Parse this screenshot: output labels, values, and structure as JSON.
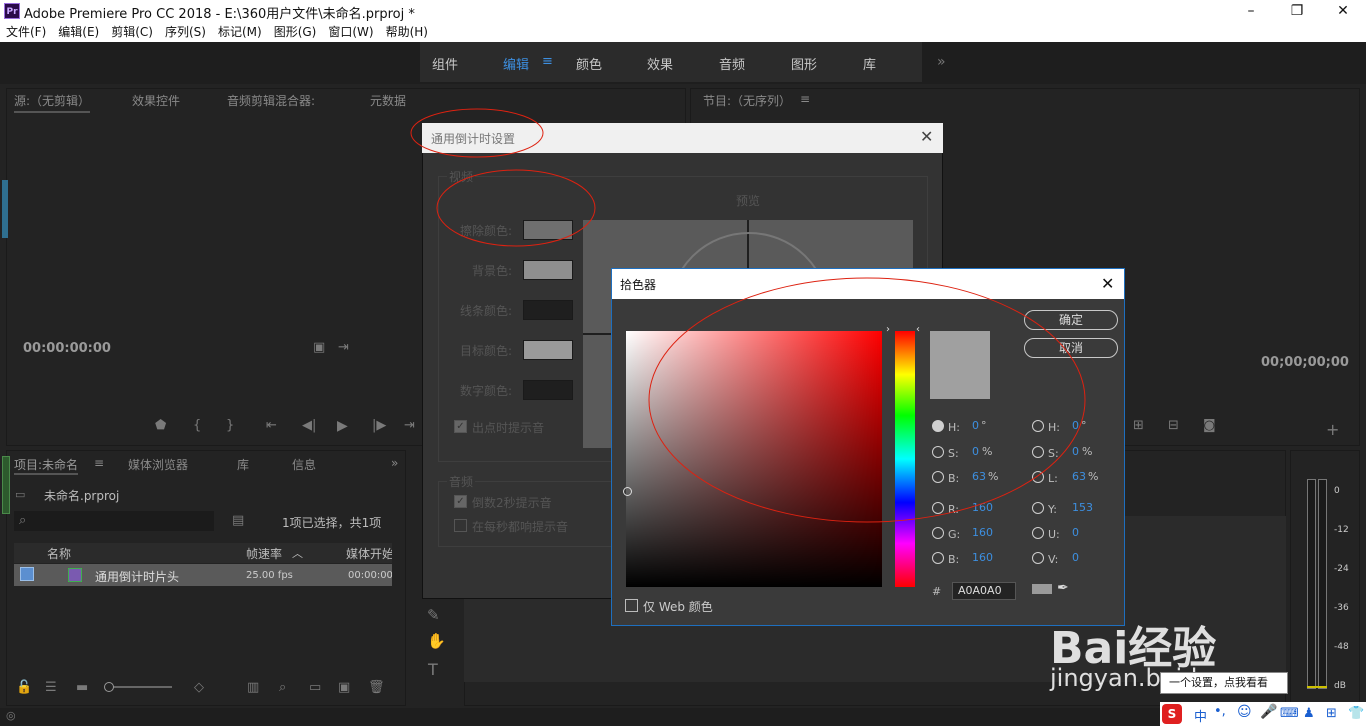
{
  "window": {
    "logo": "Pr",
    "title": "Adobe Premiere Pro CC 2018 - E:\\360用户文件\\未命名.prproj *"
  },
  "menu": [
    "文件(F)",
    "编辑(E)",
    "剪辑(C)",
    "序列(S)",
    "标记(M)",
    "图形(G)",
    "窗口(W)",
    "帮助(H)"
  ],
  "workspaces": [
    {
      "label": "组件",
      "active": false
    },
    {
      "label": "编辑",
      "active": true
    },
    {
      "label": "颜色",
      "active": false
    },
    {
      "label": "效果",
      "active": false
    },
    {
      "label": "音频",
      "active": false
    },
    {
      "label": "图形",
      "active": false
    },
    {
      "label": "库",
      "active": false
    }
  ],
  "source_panel": {
    "tabs": [
      "源:（无剪辑）",
      "效果控件",
      "音频剪辑混合器:",
      "元数据"
    ],
    "timecode": "00:00:00:00"
  },
  "program_panel": {
    "title": "节目:（无序列）",
    "timecode": "00;00;00;00"
  },
  "project_panel": {
    "tabs": [
      "项目:未命名",
      "媒体浏览器",
      "库",
      "信息"
    ],
    "file": "未命名.prproj",
    "selection": "1项已选择，共1项",
    "columns": [
      "名称",
      "帧速率",
      "媒体开始"
    ],
    "rows": [
      {
        "name": "通用倒计时片头",
        "fps": "25.00 fps",
        "start": "00:00:00"
      }
    ]
  },
  "countdown_dialog": {
    "title": "通用倒计时设置",
    "video_group": "视频",
    "preview_label": "预览",
    "labels": [
      "擦除颜色:",
      "背景色:",
      "线条颜色:",
      "目标颜色:",
      "数字颜色:"
    ],
    "swatches": [
      "#6f6f6f",
      "#8f8f8f",
      "#1f1f1f",
      "#9a9a9a",
      "#1f1f1f"
    ],
    "cue_checkbox": "出点时提示音",
    "audio_group": "音频",
    "audio_opts": [
      "倒数2秒提示音",
      "在每秒都响提示音"
    ]
  },
  "picker": {
    "title": "拾色器",
    "ok": "确定",
    "cancel": "取消",
    "color": "#a0a0a0",
    "fields_left": [
      {
        "label": "H:",
        "value": "0",
        "unit": "°",
        "on": true
      },
      {
        "label": "S:",
        "value": "0",
        "unit": "%",
        "on": false
      },
      {
        "label": "B:",
        "value": "63",
        "unit": "%",
        "on": false
      },
      {
        "label": "R:",
        "value": "160",
        "unit": "",
        "on": false
      },
      {
        "label": "G:",
        "value": "160",
        "unit": "",
        "on": false
      },
      {
        "label": "B:",
        "value": "160",
        "unit": "",
        "on": false
      }
    ],
    "fields_right": [
      {
        "label": "H:",
        "value": "0",
        "unit": "°"
      },
      {
        "label": "S:",
        "value": "0",
        "unit": "%"
      },
      {
        "label": "L:",
        "value": "63",
        "unit": "%"
      },
      {
        "label": "Y:",
        "value": "153",
        "unit": ""
      },
      {
        "label": "U:",
        "value": "0",
        "unit": ""
      },
      {
        "label": "V:",
        "value": "0",
        "unit": ""
      }
    ],
    "hash": "#",
    "hex": "A0A0A0",
    "web_only": "仅 Web 颜色"
  },
  "meter": {
    "ticks": [
      "0",
      "-12",
      "-24",
      "-36",
      "-48",
      "dB"
    ]
  },
  "watermark": {
    "brand": "Bai经验",
    "url": "jingyan.baidu.com"
  },
  "tooltip": "一个设置，点我看看",
  "accent": "#3d8fe0"
}
